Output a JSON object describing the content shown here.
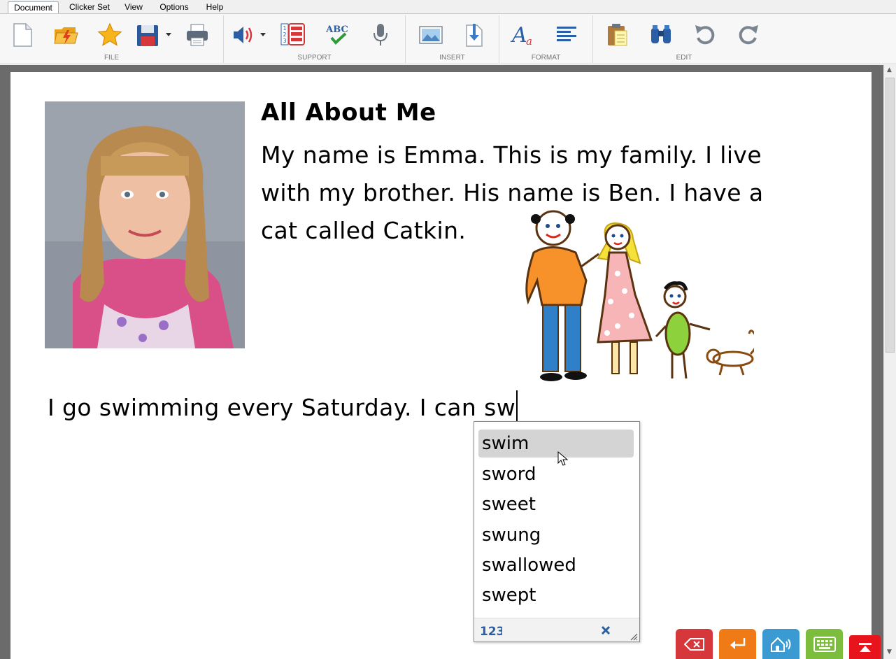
{
  "menu": {
    "tabs": [
      {
        "label": "Document",
        "active": true
      },
      {
        "label": "Clicker Set"
      },
      {
        "label": "View"
      },
      {
        "label": "Options"
      },
      {
        "label": "Help"
      }
    ]
  },
  "ribbon": {
    "groups": [
      {
        "label": "FILE",
        "buttons": [
          "new-document-icon",
          "open-folder-icon",
          "favourite-star-icon",
          "save-icon",
          "print-icon"
        ]
      },
      {
        "label": "SUPPORT",
        "buttons": [
          "speech-icon",
          "word-prediction-icon",
          "spell-check-icon",
          "microphone-icon"
        ]
      },
      {
        "label": "INSERT",
        "buttons": [
          "insert-picture-icon",
          "insert-file-icon"
        ]
      },
      {
        "label": "FORMAT",
        "buttons": [
          "font-icon",
          "align-left-icon"
        ]
      },
      {
        "label": "EDIT",
        "buttons": [
          "paste-icon",
          "find-binoculars-icon",
          "undo-icon",
          "redo-icon"
        ]
      }
    ]
  },
  "document": {
    "title": "All About Me",
    "paragraph": "My name is Emma. This is my family. I live with my brother. His name is Ben. I have a cat called Catkin.",
    "typing_line": "I go swimming every Saturday. I can sw"
  },
  "prediction": {
    "words": [
      "swim",
      "sword",
      "sweet",
      "swung",
      "swallowed",
      "swept"
    ],
    "selected_index": 0
  },
  "colors": {
    "accent_red": "#d6373a",
    "accent_orange": "#f07b16",
    "accent_blue": "#3b9ad2",
    "accent_green": "#7cbd3e",
    "ribbon_bg": "#f7f7f7"
  }
}
